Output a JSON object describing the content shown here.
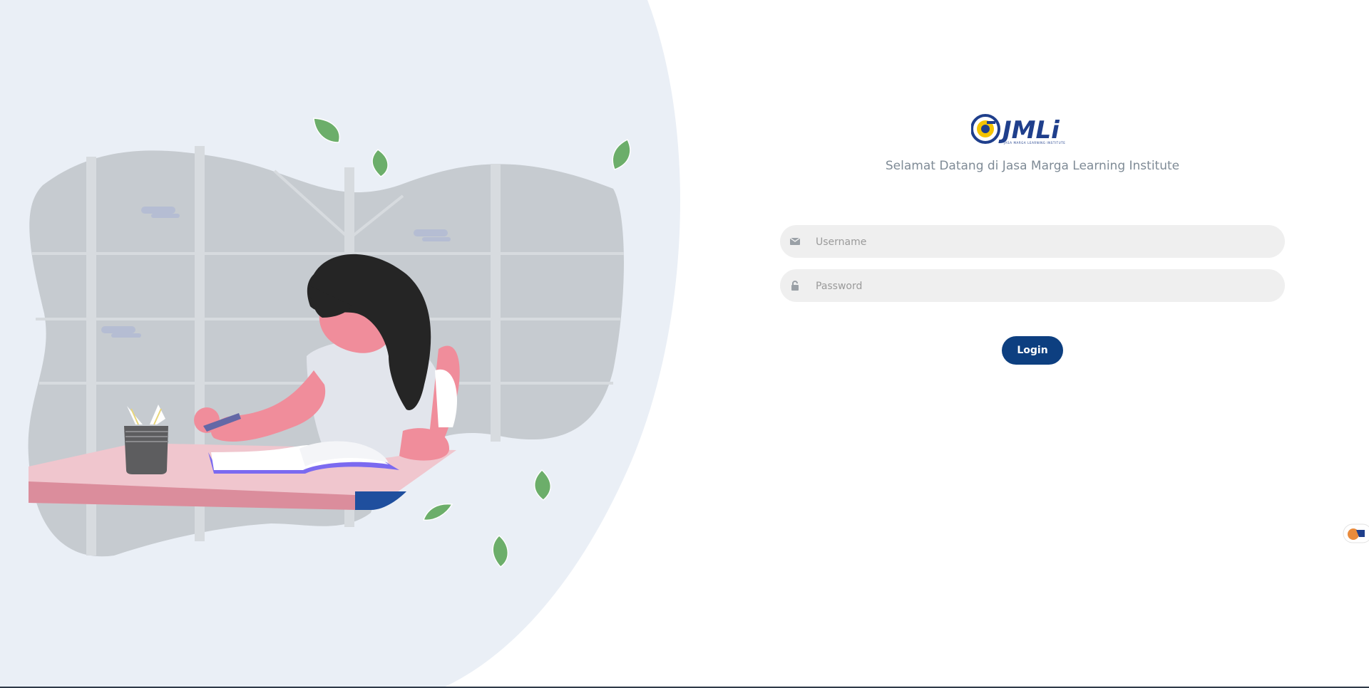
{
  "header": {
    "logo_text": "JMLi",
    "logo_subtext": "JASA MARGA LEARNING INSTITUTE",
    "welcome": "Selamat Datang di Jasa Marga Learning Institute"
  },
  "form": {
    "username": {
      "placeholder": "Username",
      "value": "",
      "icon": "envelope-icon"
    },
    "password": {
      "placeholder": "Password",
      "value": "",
      "icon": "lock-icon"
    },
    "login_label": "Login"
  },
  "colors": {
    "brand_blue": "#0d3f80",
    "brand_orange": "#f5a623",
    "background_blob": "#eaeff6",
    "field_background": "#efefef",
    "welcome_text": "#7f8b96"
  }
}
